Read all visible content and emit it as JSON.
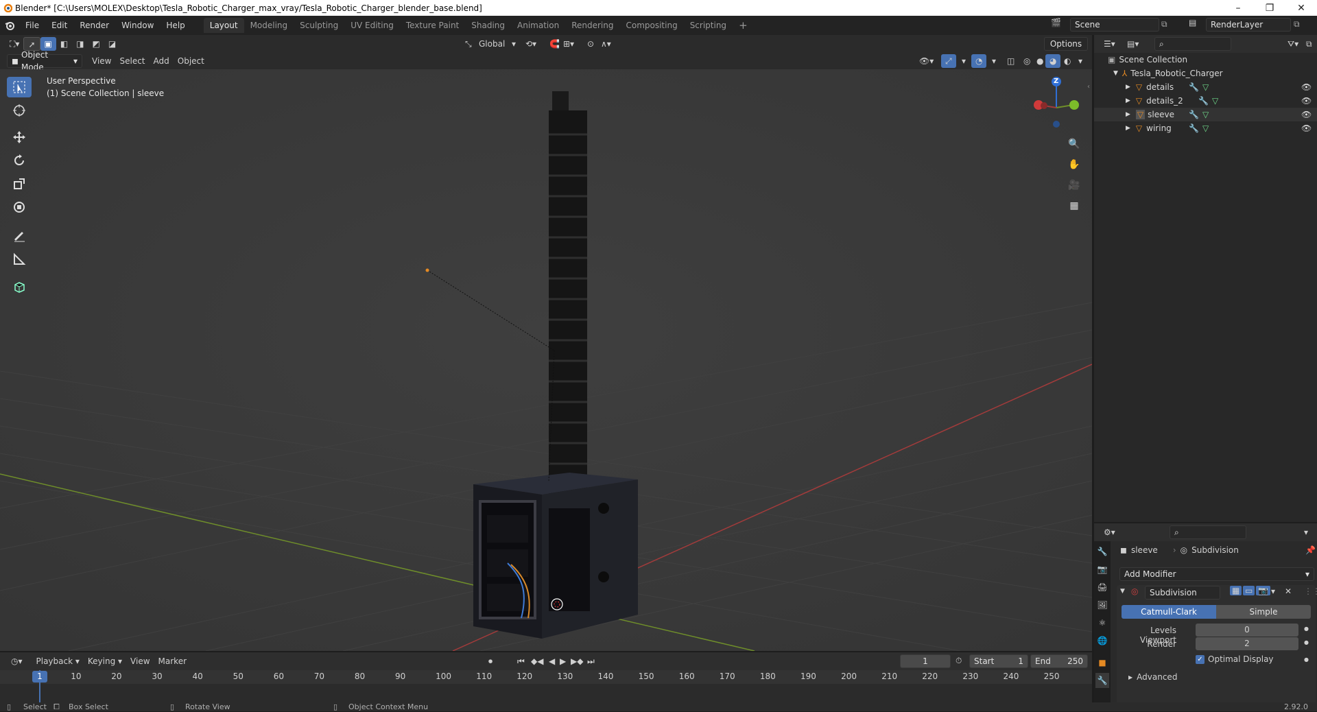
{
  "title_bar": {
    "title": "Blender* [C:\\Users\\MOLEX\\Desktop\\Tesla_Robotic_Charger_max_vray/Tesla_Robotic_Charger_blender_base.blend]",
    "minimize": "–",
    "restore": "❐",
    "close": "✕"
  },
  "menu": [
    "File",
    "Edit",
    "Render",
    "Window",
    "Help"
  ],
  "workspaces": [
    "Layout",
    "Modeling",
    "Sculpting",
    "UV Editing",
    "Texture Paint",
    "Shading",
    "Animation",
    "Rendering",
    "Compositing",
    "Scripting"
  ],
  "add_workspace": "+",
  "scene": {
    "name": "Scene",
    "render_layer": "RenderLayer"
  },
  "viewport_header": {
    "orientation": "Global",
    "options": "Options",
    "mode": "Object Mode",
    "menus": [
      "View",
      "Select",
      "Add",
      "Object"
    ]
  },
  "viewport_overlay": {
    "line1": "User Perspective",
    "line2": "(1) Scene Collection | sleeve"
  },
  "gizmo": {
    "z": "Z"
  },
  "outliner": {
    "root": "Scene Collection",
    "collection": "Tesla_Robotic_Charger",
    "items": [
      {
        "label": "details"
      },
      {
        "label": "details_2"
      },
      {
        "label": "sleeve"
      },
      {
        "label": "wiring"
      }
    ]
  },
  "properties": {
    "object": "sleeve",
    "modifier_crumb": "Subdivision",
    "add_modifier": "Add Modifier",
    "modifier_name": "Subdivision",
    "catmull": "Catmull-Clark",
    "simple": "Simple",
    "levels_viewport_label": "Levels Viewport",
    "levels_viewport": "0",
    "render_label": "Render",
    "render_value": "2",
    "optimal_display": "Optimal Display",
    "advanced": "Advanced"
  },
  "timeline": {
    "menus": [
      "Playback",
      "Keying",
      "View",
      "Marker"
    ],
    "current_frame": "1",
    "start_label": "Start",
    "start": "1",
    "end_label": "End",
    "end": "250",
    "ticks": [
      "1",
      "10",
      "20",
      "30",
      "40",
      "50",
      "60",
      "70",
      "80",
      "90",
      "100",
      "110",
      "120",
      "130",
      "140",
      "150",
      "160",
      "170",
      "180",
      "190",
      "200",
      "210",
      "220",
      "230",
      "240",
      "250"
    ]
  },
  "status": {
    "select": "Select",
    "box_select": "Box Select",
    "rotate_view": "Rotate View",
    "context_menu": "Object Context Menu",
    "version": "2.92.0"
  },
  "colors": {
    "accent": "#4772b3",
    "x_axis": "#a33b3b",
    "y_axis": "#6f8e2a",
    "z_axis": "#2f6fd6",
    "object_orange": "#e58a23"
  }
}
